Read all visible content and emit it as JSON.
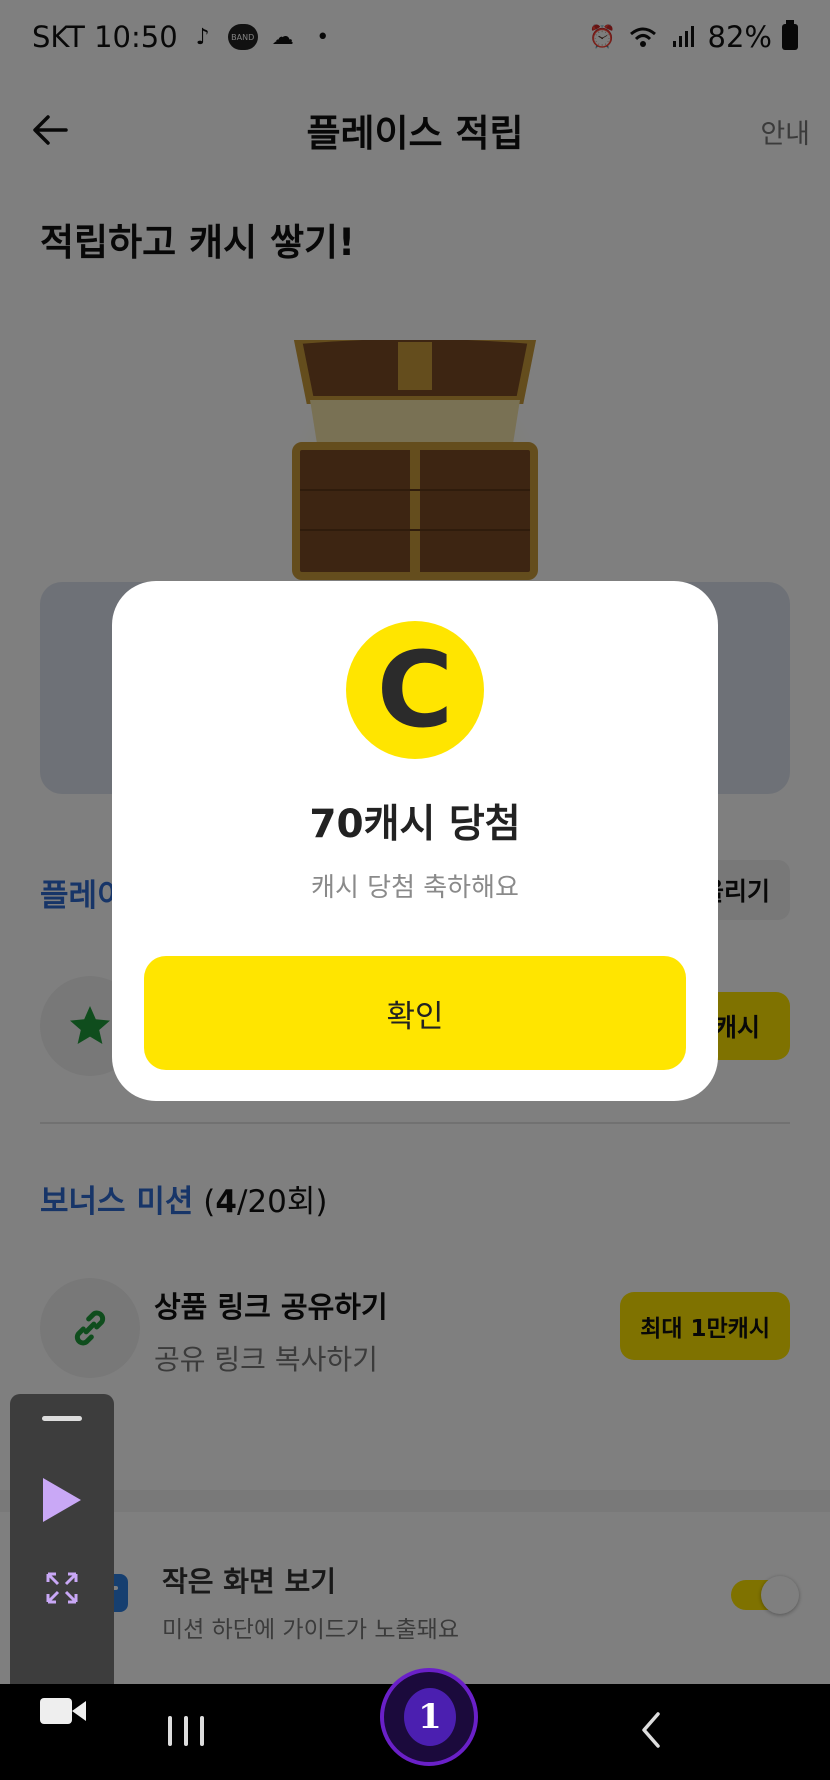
{
  "status_bar": {
    "carrier_time": "SKT 10:50",
    "band_label": "BAND",
    "battery": "82%"
  },
  "header": {
    "title": "플레이스 적립",
    "guide": "안내"
  },
  "headline": "적립하고 캐시 쌓기!",
  "place_section": {
    "title_partial": "플레이",
    "pill_partial": "올리기",
    "reward_partial": "캐시"
  },
  "bonus_mission": {
    "title": "보너스 미션",
    "count_open": "(",
    "count_bold": "4",
    "count_rest": "/20회)",
    "mission": {
      "title": "상품 링크 공유하기",
      "subtitle": "공유 링크 복사하기",
      "reward": "최대 1만캐시"
    }
  },
  "small_screen": {
    "title": "작은 화면 보기",
    "subtitle": "미션 하단에 가이드가 노출돼요",
    "enabled": true
  },
  "modal": {
    "coin_letter": "C",
    "title": "70캐시 당첨",
    "subtitle": "캐시 당첨 축하해요",
    "confirm": "확인"
  },
  "navbar": {
    "home_badge": "1"
  },
  "colors": {
    "accent_yellow": "#ffe500",
    "link_blue": "#2f6ad0",
    "recorder_purple": "#c9a8f6"
  }
}
